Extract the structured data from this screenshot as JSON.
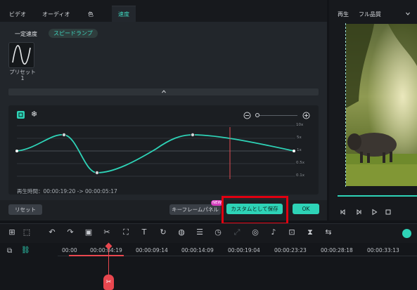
{
  "tabs": [
    {
      "label": "ビデオ",
      "active": false
    },
    {
      "label": "オーディオ",
      "active": false
    },
    {
      "label": "色",
      "active": false
    },
    {
      "label": "速度",
      "active": true
    }
  ],
  "speed_modes": {
    "constant": "一定速度",
    "ramp": "スピードランプ"
  },
  "preset": {
    "label_line1": "プリセット",
    "label_line2": "1"
  },
  "graph": {
    "y_labels": [
      "10x",
      "5x",
      "1x",
      "0.5x",
      "0.1x"
    ],
    "duration_text": "再生時間：00:00:19:20 -> 00:00:05:17"
  },
  "buttons": {
    "reset": "リセット",
    "keyframe_panel": "キーフレームパネル",
    "new_badge": "NEW",
    "save_custom": "カスタムとして保存",
    "ok": "OK"
  },
  "preview": {
    "playback_label": "再生",
    "quality": "フル品質"
  },
  "timeline": {
    "ruler": [
      "00:00",
      "00:00:04:19",
      "00:00:09:14",
      "00:00:14:09",
      "00:00:19:04",
      "00:00:23:23",
      "00:00:28:18",
      "00:00:33:13"
    ]
  },
  "colors": {
    "accent": "#2ed3b7",
    "highlight_box": "#e10010",
    "playhead": "#e9474f"
  }
}
